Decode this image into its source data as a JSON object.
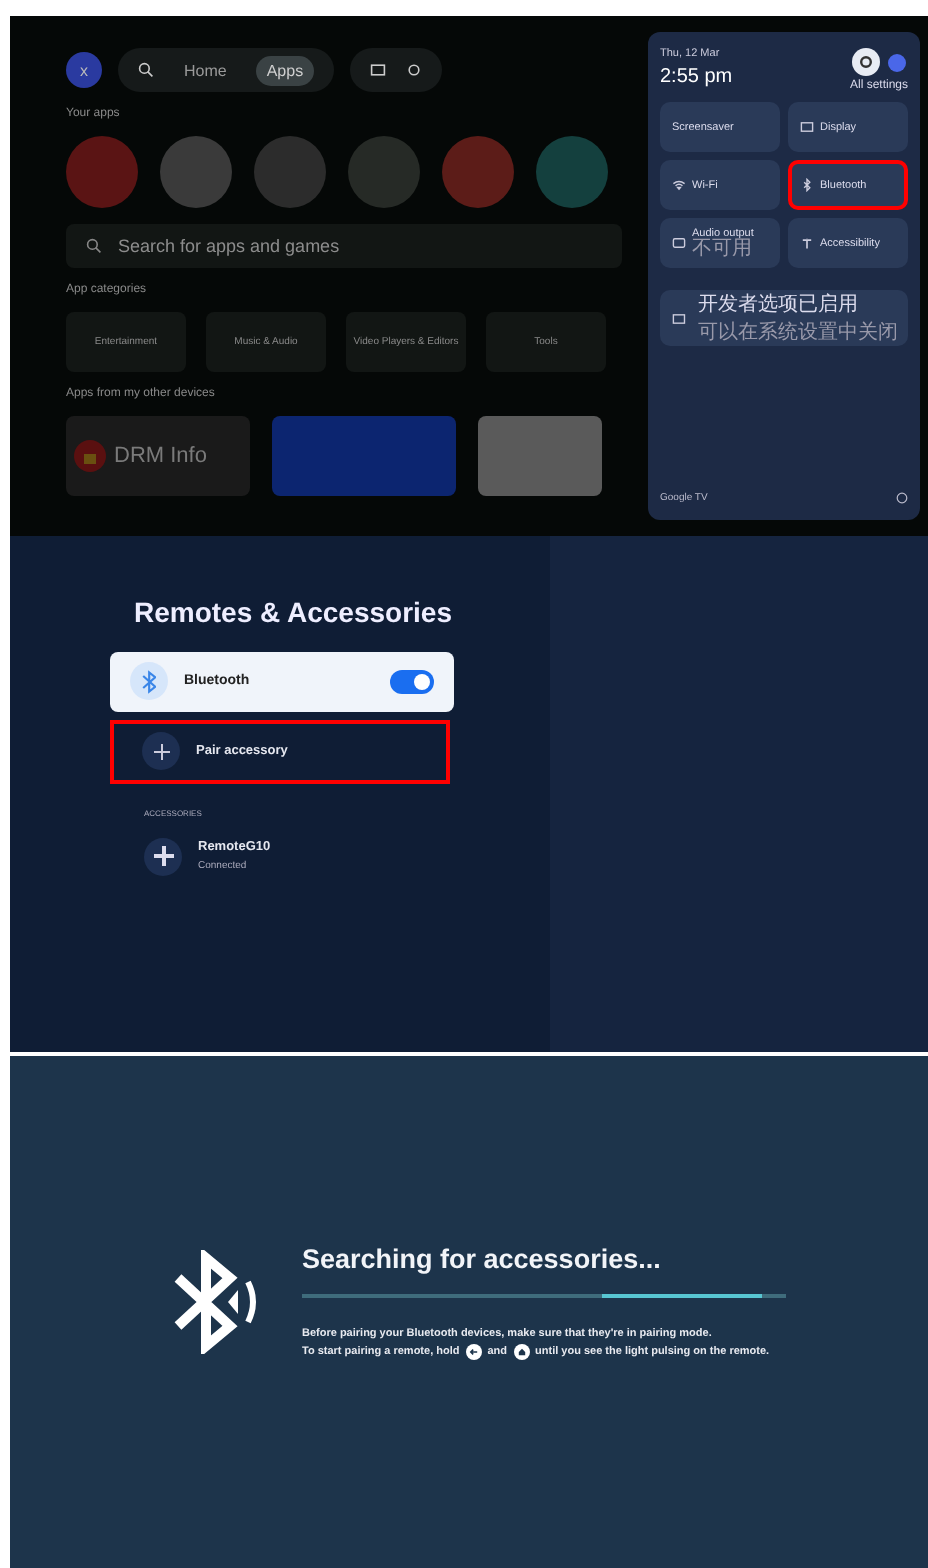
{
  "home_screen": {
    "avatar": "x",
    "nav": [
      {
        "kind": "search",
        "selected": false
      },
      {
        "kind": "tab",
        "label": "Home",
        "selected": false
      },
      {
        "kind": "tab",
        "label": "Apps",
        "selected": true
      }
    ],
    "your_apps_heading": "Your apps",
    "apps": [
      {
        "color": "#5a1414"
      },
      {
        "color": "#3a3a3a"
      },
      {
        "color": "#2c2c2c"
      },
      {
        "color": "#262a26"
      },
      {
        "color": "#5c1c18"
      },
      {
        "color": "#14403e"
      }
    ],
    "search_placeholder": "Search for apps and games",
    "categories_heading": "App categories",
    "categories": [
      "Entertainment",
      "Music & Audio",
      "Video Players & Editors",
      "Tools"
    ],
    "other_devices_heading": "Apps from my other devices",
    "device_apps": [
      {
        "kind": "drm",
        "label": "DRM Info"
      },
      {
        "kind": "blue"
      },
      {
        "kind": "play"
      }
    ]
  },
  "quick_settings": {
    "date": "Thu, 12 Mar",
    "time": "2:55 pm",
    "all_settings": "All settings",
    "tiles": [
      {
        "kind": "screensaver",
        "label": "Screensaver",
        "highlighted": false
      },
      {
        "kind": "display",
        "label": "Display",
        "highlighted": false
      },
      {
        "kind": "wifi",
        "label": "Wi-Fi",
        "highlighted": false
      },
      {
        "kind": "bluetooth",
        "label": "Bluetooth",
        "highlighted": true
      },
      {
        "kind": "audio",
        "label": "Audio output",
        "sub": "不可用",
        "highlighted": false
      },
      {
        "kind": "accessibility",
        "label": "Accessibility",
        "highlighted": false
      }
    ],
    "notice": {
      "title": "开发者选项已启用",
      "sub": "可以在系统设置中关闭"
    },
    "footer": "Google TV"
  },
  "remotes": {
    "title": "Remotes & Accessories",
    "bluetooth": {
      "label": "Bluetooth",
      "on": true
    },
    "pair": {
      "label": "Pair accessory",
      "highlighted": true
    },
    "section": "ACCESSORIES",
    "devices": [
      {
        "name": "RemoteG10",
        "status": "Connected"
      }
    ]
  },
  "searching": {
    "title": "Searching for accessories...",
    "line_1": "Before pairing your Bluetooth devices, make sure that they're in pairing mode.",
    "line_2": [
      {
        "kind": "text",
        "text": "To start pairing a remote, hold"
      },
      {
        "kind": "back"
      },
      {
        "kind": "text",
        "text": "and"
      },
      {
        "kind": "home"
      },
      {
        "kind": "text",
        "text": "until you see the light pulsing on the remote."
      }
    ]
  }
}
